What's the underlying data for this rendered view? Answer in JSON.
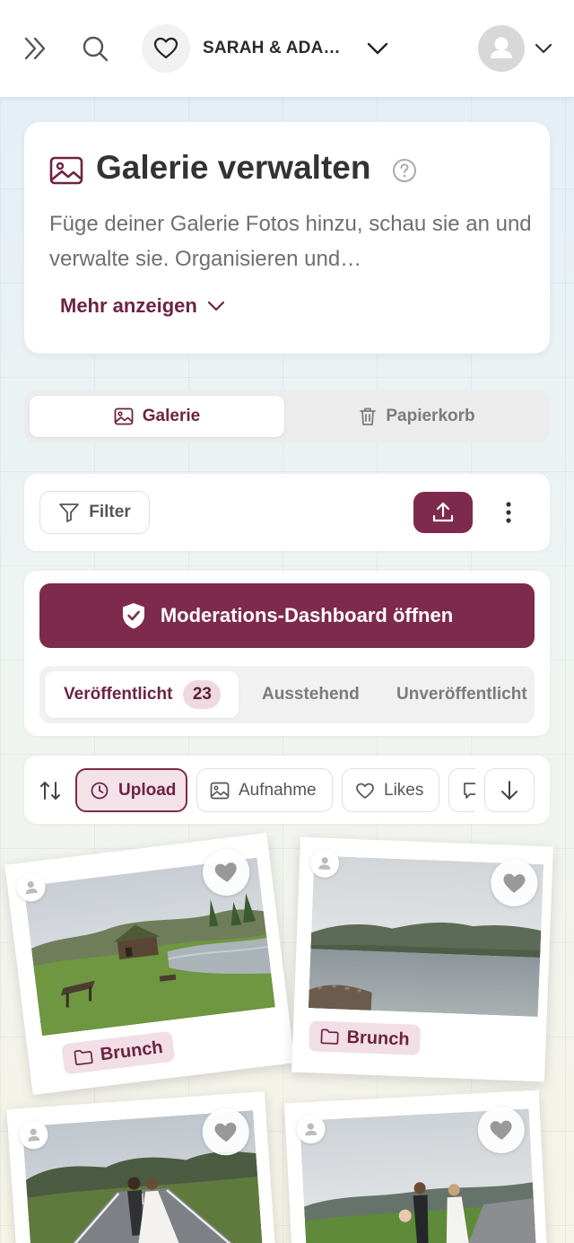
{
  "header": {
    "event_name": "SARAH & ADAM...",
    "icons": [
      "double-chevron-right-icon",
      "search-icon",
      "heart-icon",
      "chevron-down-icon",
      "user-avatar",
      "chevron-down-icon"
    ]
  },
  "page": {
    "title": "Galerie verwalten",
    "description": "Füge deiner Galerie Fotos hinzu, schau sie an und verwalte sie. Organisieren und…",
    "more_label": "Mehr anzeigen"
  },
  "tabs": {
    "gallery": "Galerie",
    "trash": "Papierkorb",
    "active": "gallery"
  },
  "toolbar": {
    "filter_label": "Filter"
  },
  "moderation": {
    "dashboard_label": "Moderations-Dashboard öffnen",
    "status_tabs": [
      {
        "label": "Veröffentlicht",
        "count": "23",
        "active": true
      },
      {
        "label": "Ausstehend"
      },
      {
        "label": "Unveröffentlicht"
      }
    ]
  },
  "sort": {
    "chips": [
      {
        "label": "Upload",
        "icon": "clock-icon",
        "active": true
      },
      {
        "label": "Aufnahme",
        "icon": "image-icon"
      },
      {
        "label": "Likes",
        "icon": "heart-icon"
      },
      {
        "label": "",
        "icon": "comment-icon"
      }
    ]
  },
  "photos": [
    {
      "album": "Brunch",
      "scene": "lake-cabin"
    },
    {
      "album": "Brunch",
      "scene": "lake-mountains"
    },
    {
      "album": "",
      "scene": "couple-road"
    },
    {
      "album": "",
      "scene": "couple-meadow"
    }
  ],
  "colors": {
    "brand": "#7d2a4c",
    "brand_text": "#6d2343",
    "brand_soft": "#f1dfe5"
  }
}
